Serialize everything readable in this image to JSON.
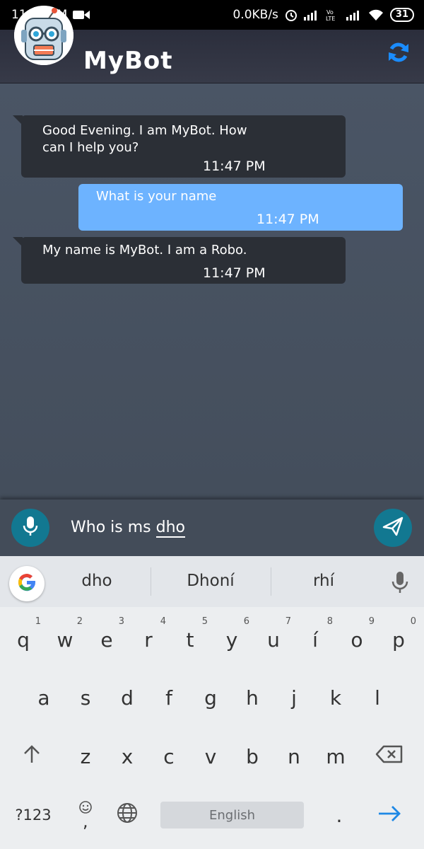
{
  "status_bar": {
    "time": "11:47 PM",
    "network_speed": "0.0KB/s",
    "battery": "31",
    "icons": [
      "video-camera-icon",
      "alarm-icon",
      "signal-icon",
      "volte-icon",
      "signal-icon",
      "wifi-icon",
      "battery-icon"
    ]
  },
  "app_bar": {
    "title": "MyBot",
    "logo_icon": "robot-icon",
    "refresh_icon": "refresh-icon",
    "accent": "#1a8cff"
  },
  "messages": [
    {
      "sender": "bot",
      "text_lines": [
        "Good Evening. I am MyBot. How",
        "can I help you?"
      ],
      "time": "11:47 PM"
    },
    {
      "sender": "user",
      "text_lines": [
        "What is your name"
      ],
      "time": "11:47 PM"
    },
    {
      "sender": "bot",
      "text_lines": [
        "My name is MyBot. I am a Robo."
      ],
      "time": "11:47 PM"
    }
  ],
  "input_bar": {
    "value_prefix": "Who is ms ",
    "value_composing": "dho",
    "mic_icon": "microphone-icon",
    "send_icon": "send-icon",
    "button_color": "#127891"
  },
  "keyboard": {
    "suggestions": [
      "dho",
      "Dhoní",
      "rhí"
    ],
    "google_icon": "google-icon",
    "row1": [
      {
        "key": "q",
        "hint": "1"
      },
      {
        "key": "w",
        "hint": "2"
      },
      {
        "key": "e",
        "hint": "3"
      },
      {
        "key": "r",
        "hint": "4"
      },
      {
        "key": "t",
        "hint": "5"
      },
      {
        "key": "y",
        "hint": "6"
      },
      {
        "key": "u",
        "hint": "7"
      },
      {
        "key": "í",
        "hint": "8"
      },
      {
        "key": "o",
        "hint": "9"
      },
      {
        "key": "p",
        "hint": "0"
      }
    ],
    "row2": [
      "a",
      "s",
      "d",
      "f",
      "g",
      "h",
      "j",
      "k",
      "l"
    ],
    "row3": [
      "z",
      "x",
      "c",
      "v",
      "b",
      "n",
      "m"
    ],
    "symbols_key": "?123",
    "comma_key": ",",
    "period_key": ".",
    "spacebar": "English",
    "icons": [
      "shift-icon",
      "backspace-icon",
      "emoji-icon",
      "globe-icon",
      "enter-arrow-icon",
      "keyboard-mic-icon"
    ]
  }
}
